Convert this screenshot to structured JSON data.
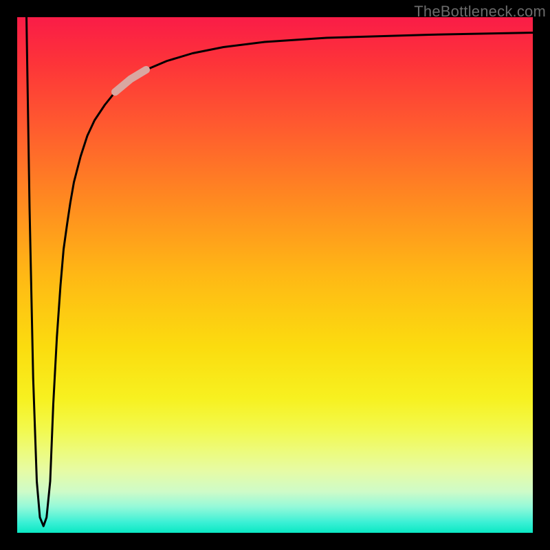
{
  "watermark_text": "TheBottleneck.com",
  "plot": {
    "inner_left": 25,
    "inner_top": 25,
    "inner_width": 750,
    "inner_height": 750
  },
  "chart_data": {
    "type": "line",
    "title": "",
    "xlabel": "",
    "ylabel": "",
    "xlim": [
      0,
      100
    ],
    "ylim": [
      0,
      100
    ],
    "x": [
      1.8,
      2.4,
      3.1,
      3.8,
      4.4,
      5.1,
      5.7,
      6.4,
      7.0,
      7.7,
      8.4,
      9.0,
      9.7,
      10.3,
      11.0,
      12.3,
      13.6,
      15,
      17,
      19,
      22,
      25,
      29,
      34,
      40,
      48,
      60,
      80,
      100
    ],
    "y": [
      100,
      63,
      30,
      10,
      3,
      1.3,
      3,
      10,
      25,
      38,
      48,
      55,
      60,
      64,
      68,
      73,
      77,
      80,
      83,
      85.5,
      88,
      89.8,
      91.5,
      93,
      94.2,
      95.2,
      96,
      96.6,
      97
    ],
    "highlight_segment": {
      "x_start": 19,
      "x_end": 25
    },
    "gradient_colors": {
      "top": "#fa1c47",
      "mid_upper": "#ff8b20",
      "mid": "#fbdc0f",
      "mid_lower": "#f2f94e",
      "bottom": "#0ae8c3"
    },
    "curve_color": "#000000",
    "highlight_color": "#d9a7a1"
  }
}
